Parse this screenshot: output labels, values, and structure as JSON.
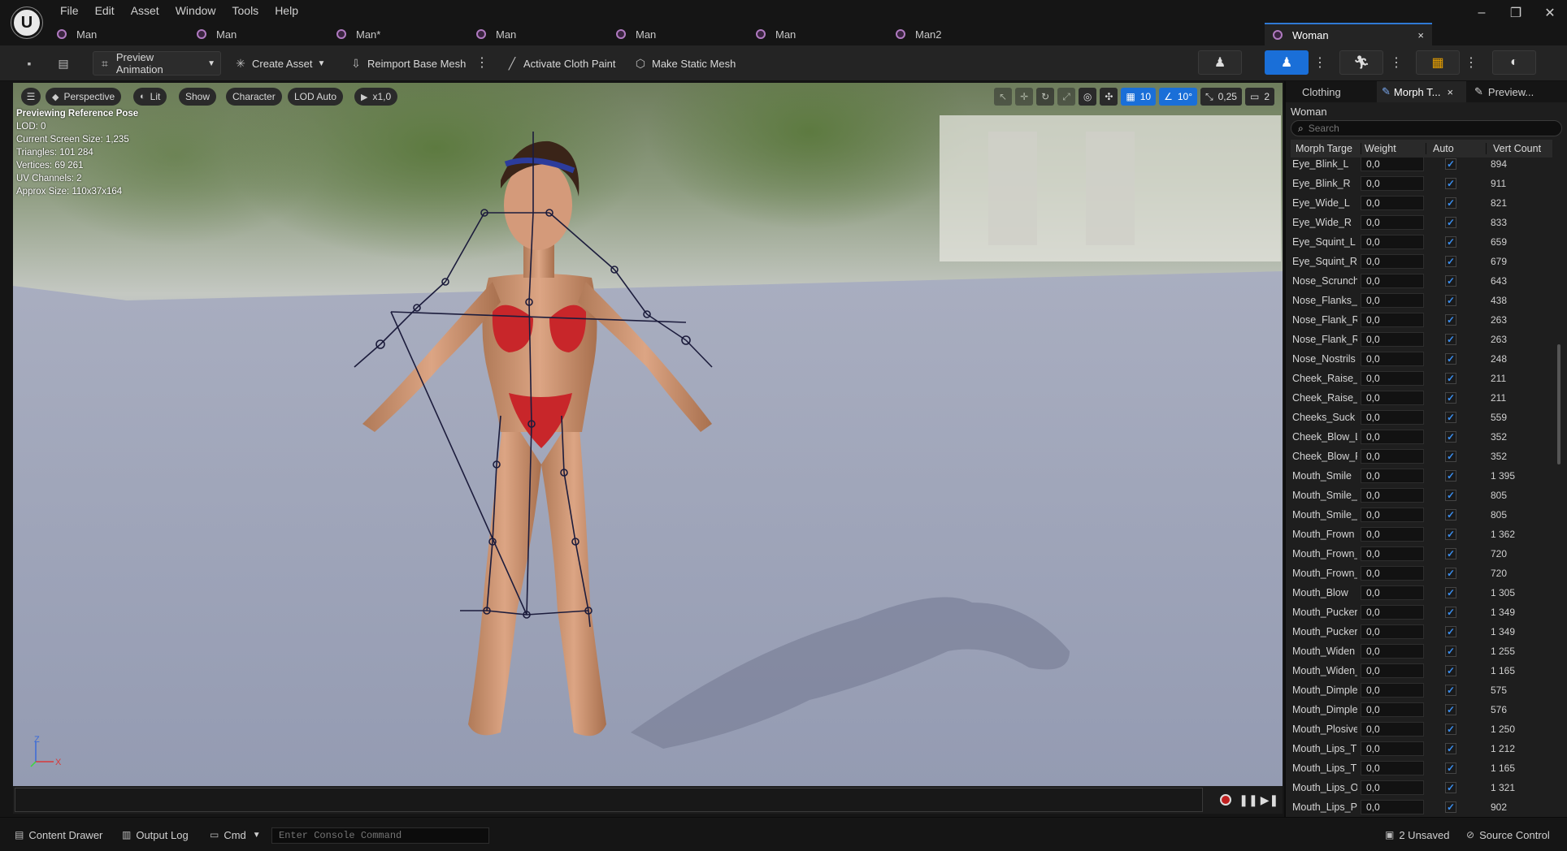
{
  "menu": [
    "File",
    "Edit",
    "Asset",
    "Window",
    "Tools",
    "Help"
  ],
  "window_controls": {
    "minimize": "–",
    "maximize": "❐",
    "close": "✕"
  },
  "tabs": [
    {
      "label": "Man"
    },
    {
      "label": "Man"
    },
    {
      "label": "Man*"
    },
    {
      "label": "Man"
    },
    {
      "label": "Man"
    },
    {
      "label": "Man"
    },
    {
      "label": "Man2"
    },
    {
      "label": "Woman",
      "active": true
    }
  ],
  "tab_close": "×",
  "toolbar": {
    "preview_animation": "Preview Animation",
    "create_asset": "Create Asset",
    "reimport": "Reimport Base Mesh",
    "activate_cloth_paint": "Activate Cloth Paint",
    "make_static_mesh": "Make Static Mesh"
  },
  "viewport": {
    "perspective": "Perspective",
    "lit": "Lit",
    "show": "Show",
    "character": "Character",
    "lod": "LOD Auto",
    "speed": "x1,0",
    "grid_value": "10",
    "angle_value": "10°",
    "scale_value": "0,25",
    "camera_speed": "2",
    "stats": [
      "Previewing Reference Pose",
      "LOD: 0",
      "Current Screen Size: 1,235",
      "Triangles: 101 284",
      "Vertices: 69 261",
      "UV Channels: 2",
      "Approx Size: 110x37x164"
    ],
    "axis": {
      "z": "Z",
      "x": "X"
    }
  },
  "panel": {
    "tabs": [
      "Clothing",
      "Morph T...",
      "Preview..."
    ],
    "asset_name": "Woman",
    "search_placeholder": "Search",
    "columns": [
      "Morph Targe",
      "Weight",
      "Auto",
      "Vert Count"
    ],
    "rows": [
      {
        "name": "Eye_Blink_L",
        "weight": "0,0",
        "verts": "894"
      },
      {
        "name": "Eye_Blink_R",
        "weight": "0,0",
        "verts": "911"
      },
      {
        "name": "Eye_Wide_L",
        "weight": "0,0",
        "verts": "821"
      },
      {
        "name": "Eye_Wide_R",
        "weight": "0,0",
        "verts": "833"
      },
      {
        "name": "Eye_Squint_L",
        "weight": "0,0",
        "verts": "659"
      },
      {
        "name": "Eye_Squint_R",
        "weight": "0,0",
        "verts": "679"
      },
      {
        "name": "Nose_Scrunch",
        "weight": "0,0",
        "verts": "643"
      },
      {
        "name": "Nose_Flanks_",
        "weight": "0,0",
        "verts": "438"
      },
      {
        "name": "Nose_Flank_R",
        "weight": "0,0",
        "verts": "263"
      },
      {
        "name": "Nose_Flank_R",
        "weight": "0,0",
        "verts": "263"
      },
      {
        "name": "Nose_Nostrils",
        "weight": "0,0",
        "verts": "248"
      },
      {
        "name": "Cheek_Raise_",
        "weight": "0,0",
        "verts": "211"
      },
      {
        "name": "Cheek_Raise_",
        "weight": "0,0",
        "verts": "211"
      },
      {
        "name": "Cheeks_Suck",
        "weight": "0,0",
        "verts": "559"
      },
      {
        "name": "Cheek_Blow_L",
        "weight": "0,0",
        "verts": "352"
      },
      {
        "name": "Cheek_Blow_R",
        "weight": "0,0",
        "verts": "352"
      },
      {
        "name": "Mouth_Smile",
        "weight": "0,0",
        "verts": "1 395"
      },
      {
        "name": "Mouth_Smile_",
        "weight": "0,0",
        "verts": "805"
      },
      {
        "name": "Mouth_Smile_",
        "weight": "0,0",
        "verts": "805"
      },
      {
        "name": "Mouth_Frown",
        "weight": "0,0",
        "verts": "1 362"
      },
      {
        "name": "Mouth_Frown_",
        "weight": "0,0",
        "verts": "720"
      },
      {
        "name": "Mouth_Frown_",
        "weight": "0,0",
        "verts": "720"
      },
      {
        "name": "Mouth_Blow",
        "weight": "0,0",
        "verts": "1 305"
      },
      {
        "name": "Mouth_Pucker",
        "weight": "0,0",
        "verts": "1 349"
      },
      {
        "name": "Mouth_Pucker",
        "weight": "0,0",
        "verts": "1 349"
      },
      {
        "name": "Mouth_Widen",
        "weight": "0,0",
        "verts": "1 255"
      },
      {
        "name": "Mouth_Widen_",
        "weight": "0,0",
        "verts": "1 165"
      },
      {
        "name": "Mouth_Dimple",
        "weight": "0,0",
        "verts": "575"
      },
      {
        "name": "Mouth_Dimple",
        "weight": "0,0",
        "verts": "576"
      },
      {
        "name": "Mouth_Plosive",
        "weight": "0,0",
        "verts": "1 250"
      },
      {
        "name": "Mouth_Lips_T",
        "weight": "0,0",
        "verts": "1 212"
      },
      {
        "name": "Mouth_Lips_T",
        "weight": "0,0",
        "verts": "1 165"
      },
      {
        "name": "Mouth_Lips_O",
        "weight": "0,0",
        "verts": "1 321"
      },
      {
        "name": "Mouth_Lips_P",
        "weight": "0,0",
        "verts": "902"
      }
    ],
    "checkmark": "✓"
  },
  "status": {
    "content_drawer": "Content Drawer",
    "output_log": "Output Log",
    "cmd": "Cmd",
    "console_placeholder": "Enter Console Command",
    "unsaved": "2 Unsaved",
    "source_control": "Source Control"
  },
  "colors": {
    "accent": "#1a6fd8",
    "tab_icon": "#b07ac0",
    "bikini": "#c8262a",
    "bones": "#1c1c3c"
  }
}
